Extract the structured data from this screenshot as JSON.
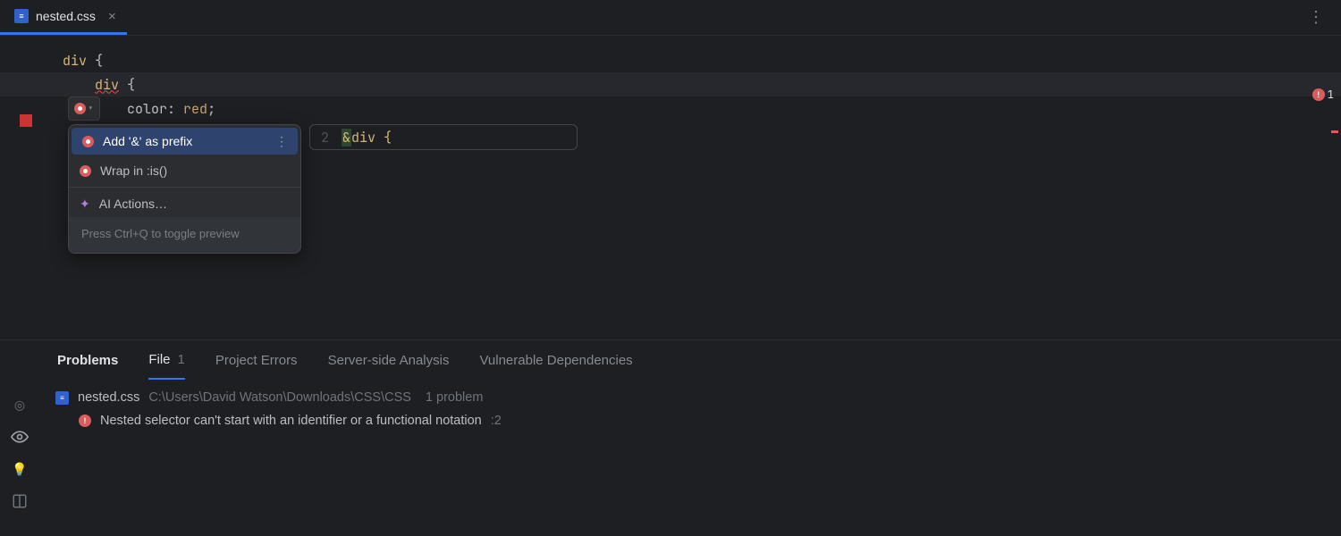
{
  "tab": {
    "filename": "nested.css",
    "icon_text": "≡"
  },
  "editor": {
    "lines": {
      "l1_selector": "div",
      "l1_brace": " {",
      "l2_selector": "div",
      "l2_brace": " {",
      "l3_prop": "color",
      "l3_colon": ": ",
      "l3_val": "red",
      "l3_semi": ";"
    },
    "error_count": "1"
  },
  "popup": {
    "item1": "Add '&' as prefix",
    "item2": "Wrap in :is()",
    "item3": "AI Actions…",
    "hint": "Press Ctrl+Q to toggle preview"
  },
  "preview": {
    "line_no": "2",
    "amp": "&",
    "rest": " div {"
  },
  "panel": {
    "tabs": {
      "problems": "Problems",
      "file": "File",
      "file_count": "1",
      "project_errors": "Project Errors",
      "server": "Server-side Analysis",
      "vuln": "Vulnerable Dependencies"
    },
    "file": {
      "name": "nested.css",
      "path": "C:\\Users\\David Watson\\Downloads\\CSS\\CSS",
      "summary": "1 problem"
    },
    "issue": {
      "text": "Nested selector can't start with an identifier or a functional notation",
      "loc": ":2"
    }
  }
}
